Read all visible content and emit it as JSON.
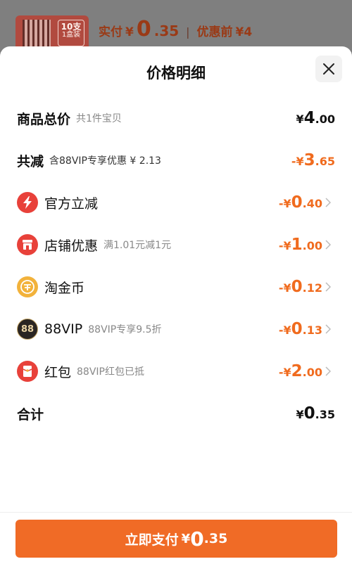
{
  "background": {
    "thumb_count": "10支",
    "thumb_sub": "1盒装",
    "paid_label": "实付",
    "currency": "¥",
    "paid_int": "0",
    "paid_dec": ".35",
    "before_label": "优惠前",
    "before_value": "¥4"
  },
  "sheet": {
    "title": "价格明细",
    "rows": [
      {
        "label": "商品总价",
        "sub": "共1件宝贝",
        "sign": "",
        "currency": "¥",
        "int": "4",
        "dec": ".00"
      },
      {
        "label": "共减",
        "sub": "含88VIP专享优惠 ¥ 2.13",
        "sign": "-",
        "currency": "¥",
        "int": "3",
        "dec": ".65"
      },
      {
        "label": "官方立减",
        "sub": "",
        "sign": "-",
        "currency": "¥",
        "int": "0",
        "dec": ".40",
        "icon": "lightning-icon"
      },
      {
        "label": "店铺优惠",
        "sub": "满1.01元减1元",
        "sign": "-",
        "currency": "¥",
        "int": "1",
        "dec": ".00",
        "icon": "shop-icon"
      },
      {
        "label": "淘金币",
        "sub": "",
        "sign": "-",
        "currency": "¥",
        "int": "0",
        "dec": ".12",
        "icon": "coin-icon"
      },
      {
        "label": "88VIP",
        "sub": "88VIP专享9.5折",
        "sign": "-",
        "currency": "¥",
        "int": "0",
        "dec": ".13",
        "icon": "vip88-icon",
        "icon_text": "88"
      },
      {
        "label": "红包",
        "sub": "88VIP红包已抵",
        "sign": "-",
        "currency": "¥",
        "int": "2",
        "dec": ".00",
        "icon": "red-packet-icon"
      },
      {
        "label": "合计",
        "sub": "",
        "sign": "",
        "currency": "¥",
        "int": "0",
        "dec": ".35"
      }
    ]
  },
  "footer": {
    "pay_label": "立即支付",
    "currency": "¥",
    "int": "0",
    "dec": ".35"
  },
  "colors": {
    "accent": "#f06b26",
    "discount": "#f06b1e",
    "icon_red": "#e8413a",
    "icon_gold": "#f2b23b",
    "icon_dark": "#2a2522"
  }
}
